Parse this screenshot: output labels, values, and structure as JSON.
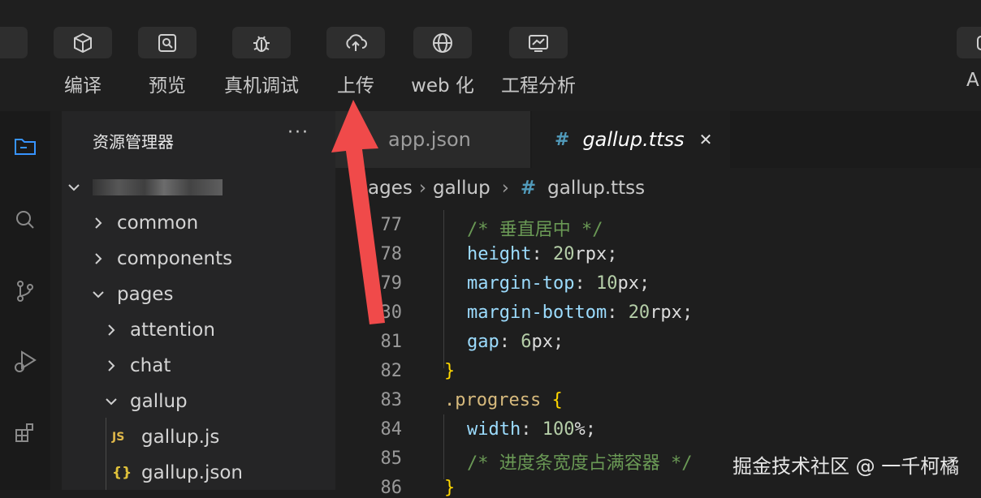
{
  "toolbar": {
    "buttons": [
      {
        "label": "编译",
        "icon": "cube-icon"
      },
      {
        "label": "预览",
        "icon": "preview-icon"
      },
      {
        "label": "真机调试",
        "icon": "bug-icon"
      },
      {
        "label": "上传",
        "icon": "cloud-upload-icon"
      },
      {
        "label": "web 化",
        "icon": "globe-icon"
      },
      {
        "label": "工程分析",
        "icon": "analysis-icon"
      }
    ],
    "right_label": "AI"
  },
  "explorer": {
    "title": "资源管理器",
    "more": "···",
    "items": [
      {
        "label": "common"
      },
      {
        "label": "components"
      },
      {
        "label": "pages"
      },
      {
        "label": "attention"
      },
      {
        "label": "chat"
      },
      {
        "label": "gallup"
      },
      {
        "label": "gallup.js",
        "badge": "JS"
      },
      {
        "label": "gallup.json",
        "badge": "{}"
      }
    ]
  },
  "tabs": [
    {
      "label": "app.json"
    },
    {
      "label": "gallup.ttss",
      "prefix": "#",
      "close": "✕"
    }
  ],
  "breadcrumb": {
    "parts": [
      "ages",
      "gallup",
      "gallup.ttss"
    ],
    "separator": "›",
    "hash": "#"
  },
  "code": {
    "line_numbers": [
      "77",
      "78",
      "79",
      "30",
      "81",
      "82",
      "83",
      "84",
      "85",
      "86"
    ],
    "lines": [
      {
        "comment": "/* 垂直居中 */"
      },
      {
        "prop": "height",
        "num": "20",
        "unit": "rpx"
      },
      {
        "prop": "margin-top",
        "num": "10",
        "unit": "px"
      },
      {
        "prop": "margin-bottom",
        "num": "20",
        "unit": "rpx"
      },
      {
        "prop": "gap",
        "num": "6",
        "unit": "px"
      },
      {
        "brace": "}"
      },
      {
        "selector": ".progress",
        "brace": "{"
      },
      {
        "prop": "width",
        "num": "100",
        "unit": "%"
      },
      {
        "comment": "/* 进度条宽度占满容器 */"
      },
      {
        "brace": "}"
      }
    ]
  },
  "watermark": "掘金技术社区 @ 一千柯橘",
  "colors": {
    "arrow": "#f04a4a",
    "accent": "#3794ff"
  }
}
